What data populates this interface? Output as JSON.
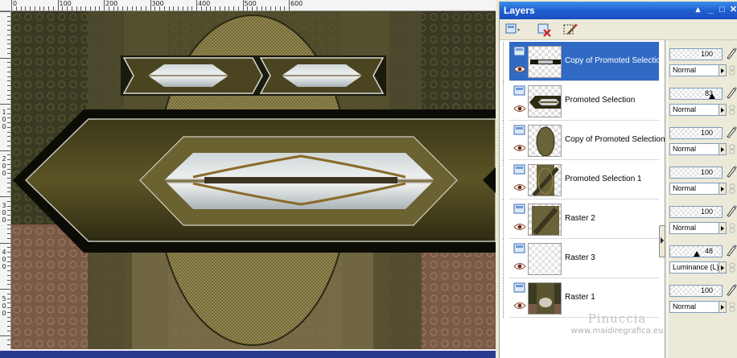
{
  "ruler": {
    "x_labels": [
      "0",
      "100",
      "200",
      "300",
      "400",
      "500",
      "600"
    ],
    "y_labels": [
      "1",
      "0",
      "0",
      "2",
      "0",
      "0",
      "3",
      "0",
      "0",
      "4",
      "0",
      "0",
      "5",
      "0",
      "0"
    ]
  },
  "panel": {
    "title": "Layers",
    "title_controls": [
      "pin-icon",
      "minimize-icon",
      "restore-icon",
      "close-icon"
    ],
    "toolbar": [
      "new-layer-icon",
      "delete-layer-icon",
      "edit-selection-icon"
    ]
  },
  "layers": [
    {
      "name": "Copy of Promoted Selection",
      "opacity": "100",
      "opacity_fraction": 1.0,
      "blend": "Normal",
      "selected": true
    },
    {
      "name": "Promoted Selection",
      "opacity": "83",
      "opacity_fraction": 0.83,
      "blend": "Normal",
      "selected": false
    },
    {
      "name": "Copy of Promoted Selection",
      "opacity": "100",
      "opacity_fraction": 1.0,
      "blend": "Normal",
      "selected": false
    },
    {
      "name": "Promoted Selection 1",
      "opacity": "100",
      "opacity_fraction": 1.0,
      "blend": "Normal",
      "selected": false
    },
    {
      "name": "Raster 2",
      "opacity": "100",
      "opacity_fraction": 1.0,
      "blend": "Normal",
      "selected": false
    },
    {
      "name": "Raster 3",
      "opacity": "48",
      "opacity_fraction": 0.48,
      "blend": "Luminance (L)",
      "selected": false
    },
    {
      "name": "Raster 1",
      "opacity": "100",
      "opacity_fraction": 1.0,
      "blend": "Normal",
      "selected": false
    }
  ],
  "watermark": {
    "name": "Pinuccia",
    "url": "www.maidiregrafica.eu"
  },
  "colors": {
    "title_bar": "#1f5fd3",
    "selected_row": "#316ac5",
    "canvas_dark": "#3a3922",
    "canvas_brown": "#7a5a46",
    "gold": "#8a7a3a"
  }
}
